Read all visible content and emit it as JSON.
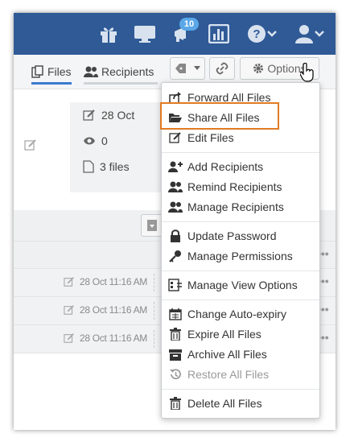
{
  "topbar": {
    "notification_count": "10",
    "icons": [
      "gift-icon",
      "monitor-icon",
      "megaphone-icon",
      "bar-chart-icon",
      "help-icon",
      "user-icon"
    ]
  },
  "tabs": {
    "files": "Files",
    "recipients": "Recipients"
  },
  "toolbar": {
    "options": "Options"
  },
  "info": {
    "date": "28 Oct",
    "views": "0",
    "files": "3 files"
  },
  "rows": [
    {
      "date": "28 Oct 11:16 AM"
    },
    {
      "date": "28 Oct 11:16 AM"
    },
    {
      "date": "28 Oct 11:16 AM"
    }
  ],
  "menu": {
    "forward_all": "Forward All Files",
    "share_all": "Share All Files",
    "edit": "Edit Files",
    "add_recipients": "Add Recipients",
    "remind_recipients": "Remind Recipients",
    "manage_recipients": "Manage Recipients",
    "update_password": "Update Password",
    "manage_permissions": "Manage Permissions",
    "manage_view_options": "Manage View Options",
    "change_auto_expiry": "Change Auto-expiry",
    "expire_all": "Expire All Files",
    "archive_all": "Archive All Files",
    "restore_all": "Restore All Files",
    "delete_all": "Delete All Files"
  },
  "colors": {
    "topbar": "#2f5a96",
    "badge": "#5aa7e8",
    "highlight": "#e07b22",
    "active_tab": "#3b7bd1"
  }
}
